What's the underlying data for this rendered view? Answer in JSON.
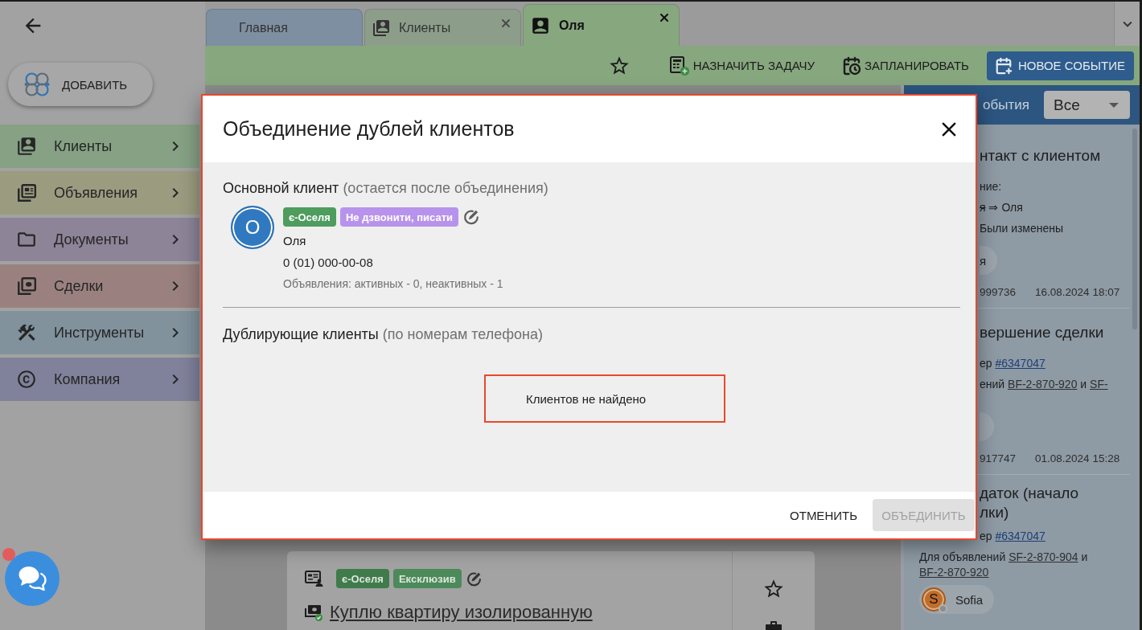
{
  "sidebar": {
    "add_button": {
      "label": "ДОБАВИТЬ"
    },
    "items": [
      {
        "label": "Клиенты",
        "kind": "clients",
        "color": "#86a184"
      },
      {
        "label": "Объявления",
        "kind": "listings",
        "color": "#9b9b80"
      },
      {
        "label": "Документы",
        "kind": "documents",
        "color": "#8d8498"
      },
      {
        "label": "Сделки",
        "kind": "deals",
        "color": "#9a817f"
      },
      {
        "label": "Инструменты",
        "kind": "tools",
        "color": "#81929d"
      },
      {
        "label": "Компания",
        "kind": "company",
        "color": "#80829b"
      }
    ]
  },
  "tabs": [
    {
      "label": "Главная",
      "kind": "home",
      "selected": false,
      "closable": false,
      "color": "#7e8fa1"
    },
    {
      "label": "Клиенты",
      "kind": "clients",
      "selected": false,
      "closable": true,
      "color": "#8c9e8a"
    },
    {
      "label": "Оля",
      "kind": "client",
      "selected": true,
      "closable": true,
      "color": "#87a77f"
    }
  ],
  "toolbar": [
    {
      "kind": "favorite"
    },
    {
      "kind": "task",
      "label": "НАЗНАЧИТЬ ЗАДАЧУ"
    },
    {
      "kind": "schedule",
      "label": "ЗАПЛАНИРОВАТЬ"
    },
    {
      "kind": "new_event",
      "label": "НОВОЕ СОБЫТИЕ"
    }
  ],
  "listing_card": {
    "tags": [
      {
        "label": "є-Оселя",
        "color": "#3f7b4b"
      },
      {
        "label": "Ексклюзив",
        "color": "#4c8a5a"
      }
    ],
    "title": "Куплю квартиру изолированную"
  },
  "events_panel": {
    "title": "обытия",
    "filter": "Все",
    "events": [
      {
        "title_lines": [
          "нтакт с клиентом"
        ],
        "details": [
          [
            {
              "kind": "text",
              "text": "ние:"
            }
          ],
          [
            {
              "kind": "old",
              "text": "я"
            },
            {
              "kind": "text",
              "text": "⇒"
            },
            {
              "kind": "text",
              "text": "Оля"
            }
          ],
          [
            {
              "kind": "text",
              "text": "Были изменены"
            }
          ]
        ],
        "chip": {
          "kind": "covered",
          "label": "я"
        },
        "number": "999736",
        "date": "16.08.2024 18:07"
      },
      {
        "title_lines": [
          "вершение сделки"
        ],
        "details": [
          [
            {
              "kind": "text",
              "text": "ер"
            },
            {
              "kind": "link",
              "text": "#6347047"
            }
          ],
          [
            {
              "kind": "text",
              "text": "ений"
            },
            {
              "kind": "ref",
              "text": "BF-2-870-920"
            },
            {
              "kind": "text",
              "text": "и"
            },
            {
              "kind": "ref",
              "text": "SF-"
            }
          ]
        ],
        "chip": {
          "kind": "covered"
        },
        "number": "917747",
        "date": "01.08.2024 15:28"
      },
      {
        "title_lines": [
          "даток (начало",
          "лки)"
        ],
        "details": [
          [
            {
              "kind": "text",
              "text": "ер"
            },
            {
              "kind": "link",
              "text": "#6347047"
            }
          ],
          [
            {
              "kind": "text",
              "text": "Для объявлений"
            },
            {
              "kind": "ref",
              "text": "SF-2-870-904"
            },
            {
              "kind": "text",
              "text": "и"
            },
            {
              "kind": "ref",
              "text": "BF-2-870-920"
            }
          ]
        ],
        "chip": {
          "kind": "full",
          "initial": "S",
          "label": "Sofia"
        }
      }
    ]
  },
  "dialog": {
    "title": "Объединение дублей клиентов",
    "main_client": {
      "heading": "Основной клиент",
      "note": "(остается после объединения)",
      "initial": "О",
      "tags": [
        {
          "label": "є-Оселя",
          "color": "#4e9c5e"
        },
        {
          "label": "Не дзвонити, писати",
          "color": "#b893ec"
        }
      ],
      "name": "Оля",
      "phone": "0 (01) 000-00-08",
      "listings": "Объявления: активных - 0, неактивных - 1"
    },
    "duplicates": {
      "heading": "Дублирующие клиенты",
      "note": "(по номерам телефона)",
      "empty_message": "Клиентов не найдено"
    },
    "buttons": [
      {
        "label": "ОТМЕНИТЬ",
        "kind": "text",
        "disabled": false
      },
      {
        "label": "ОБЪЕДИНИТЬ",
        "kind": "contained",
        "disabled": true
      }
    ]
  }
}
